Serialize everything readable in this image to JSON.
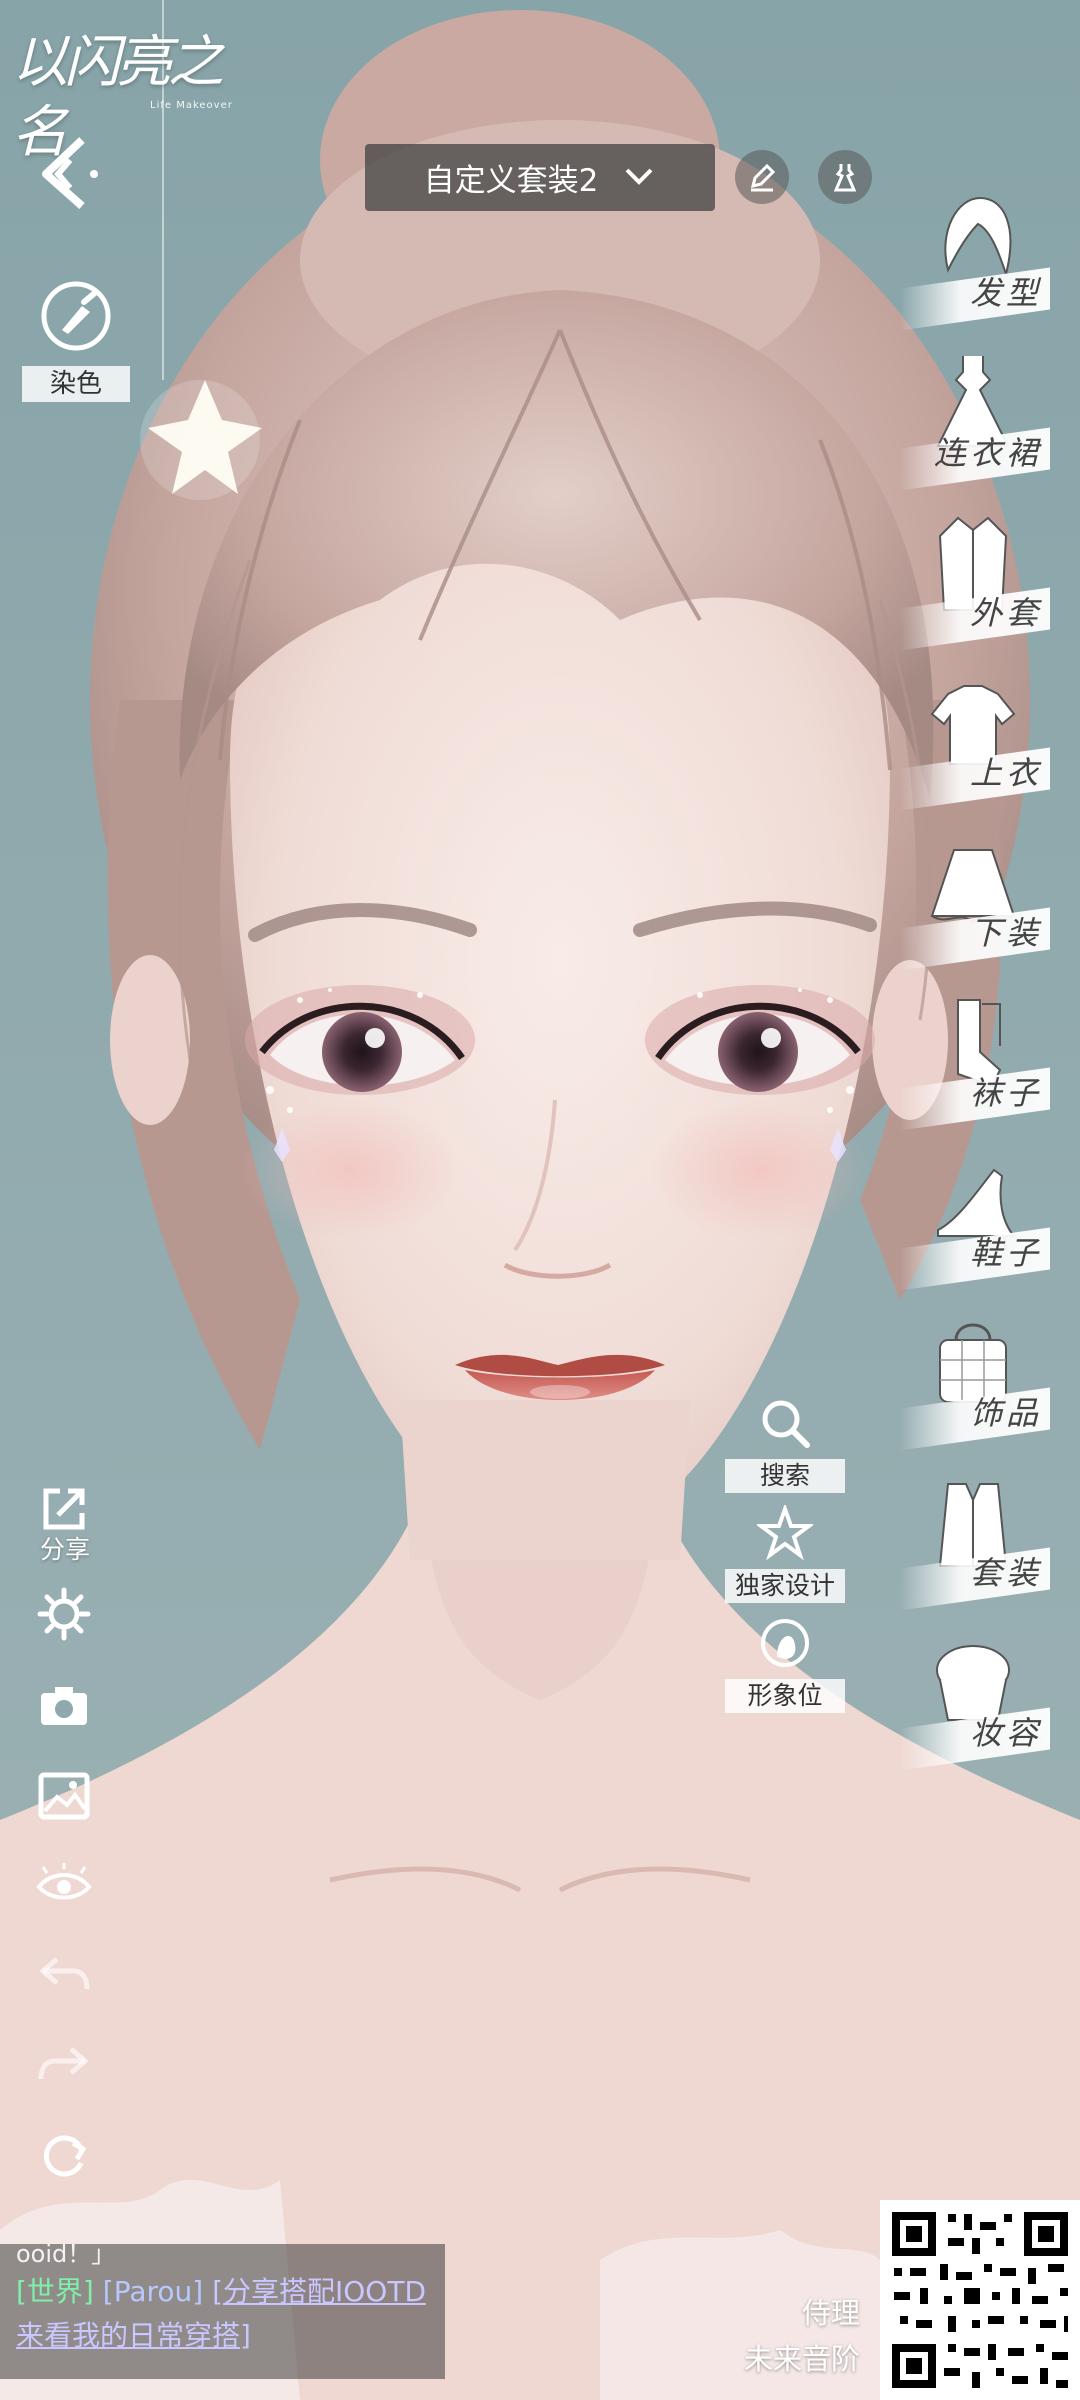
{
  "app": {
    "logo_text": "以闪亮之名",
    "logo_sub": "Life Makeover"
  },
  "top_bar": {
    "outfit_name": "自定义套装2"
  },
  "left_panel": {
    "dye_label": "染色",
    "share_label": "分享"
  },
  "categories": [
    {
      "label": "发型",
      "icon": "hair-icon"
    },
    {
      "label": "连衣裙",
      "icon": "dress-icon"
    },
    {
      "label": "外套",
      "icon": "coat-icon"
    },
    {
      "label": "上衣",
      "icon": "top-icon"
    },
    {
      "label": "下装",
      "icon": "skirt-icon"
    },
    {
      "label": "袜子",
      "icon": "socks-icon"
    },
    {
      "label": "鞋子",
      "icon": "shoe-icon"
    },
    {
      "label": "饰品",
      "icon": "bag-icon"
    },
    {
      "label": "套装",
      "icon": "suit-icon"
    },
    {
      "label": "妆容",
      "icon": "makeup-icon"
    }
  ],
  "actions": {
    "search": "搜索",
    "exclusive": "独家设计",
    "image_slot": "形象位"
  },
  "chat": {
    "partial_line": "ooid！」",
    "channel": "[世界]",
    "user": "[Parou]",
    "message_line1": "[分享搭配IOOTD",
    "message_line2": "来看我的日常穿搭]"
  },
  "signature": {
    "line1": "侍理",
    "line2": "未来音阶"
  },
  "colors": {
    "background": "#8fa9ad",
    "hair": "#c9aea8",
    "skin": "#f0ddd8",
    "chat_world": "#7ff0a8"
  }
}
